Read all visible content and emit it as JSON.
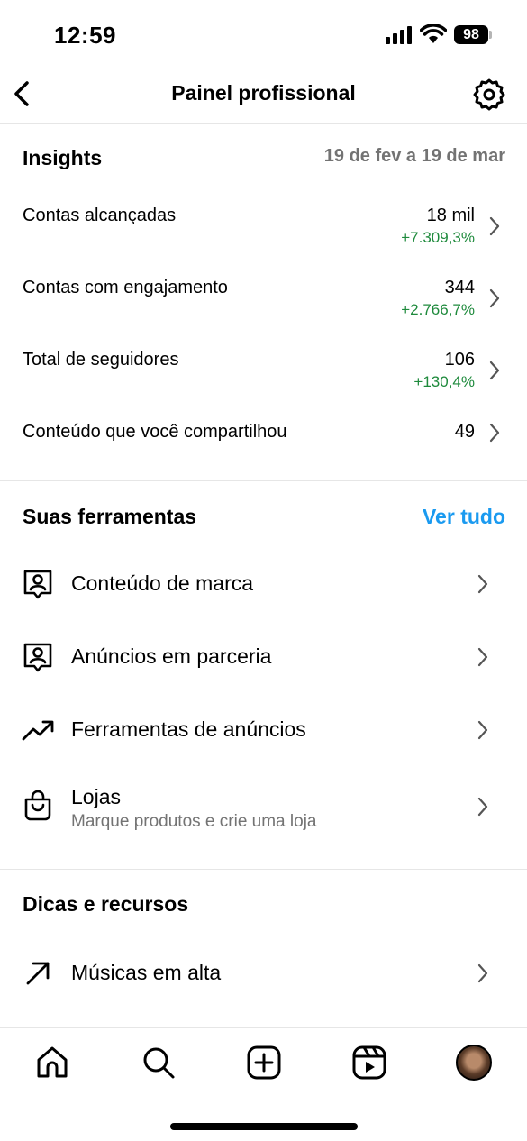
{
  "status_bar": {
    "time": "12:59",
    "battery": "98"
  },
  "header": {
    "title": "Painel profissional"
  },
  "insights": {
    "title": "Insights",
    "date_range": "19 de fev a 19 de mar",
    "metrics": [
      {
        "label": "Contas alcançadas",
        "value": "18 mil",
        "change": "+7.309,3%"
      },
      {
        "label": "Contas com engajamento",
        "value": "344",
        "change": "+2.766,7%"
      },
      {
        "label": "Total de seguidores",
        "value": "106",
        "change": "+130,4%"
      },
      {
        "label": "Conteúdo que você compartilhou",
        "value": "49",
        "change": ""
      }
    ]
  },
  "tools": {
    "title": "Suas ferramentas",
    "see_all": "Ver tudo",
    "items": [
      {
        "label": "Conteúdo de marca",
        "icon": "branded-content-icon"
      },
      {
        "label": "Anúncios em parceria",
        "icon": "partnership-ads-icon"
      },
      {
        "label": "Ferramentas de anúncios",
        "icon": "trending-up-icon"
      },
      {
        "label": "Lojas",
        "subtitle": "Marque produtos e crie uma loja",
        "icon": "shopping-bag-icon"
      }
    ]
  },
  "tips": {
    "title": "Dicas e recursos",
    "items": [
      {
        "label": "Músicas em alta",
        "icon": "arrow-up-right-icon"
      }
    ]
  },
  "colors": {
    "positive": "#1e8a3c",
    "link": "#1a9af0",
    "muted": "#737373"
  }
}
